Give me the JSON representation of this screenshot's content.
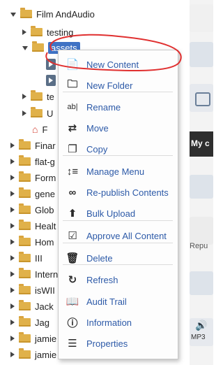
{
  "tree": {
    "root_label": "Film AndAudio",
    "testing": "testing",
    "assets": "assets",
    "te": "te",
    "u": "U",
    "f": "F",
    "items": [
      "Finar",
      "flat-g",
      "Form",
      "gene",
      "Glob",
      "Healt",
      "Hom",
      "III",
      "Intern",
      "isWII",
      "Jack",
      "Jag",
      "jamie",
      "jamie"
    ]
  },
  "menu": {
    "items": [
      {
        "label": "New Content",
        "icon": "new-content-icon"
      },
      {
        "label": "New Folder",
        "icon": "new-folder-icon"
      },
      {
        "label": "Rename",
        "icon": "rename-icon"
      },
      {
        "label": "Move",
        "icon": "move-icon"
      },
      {
        "label": "Copy",
        "icon": "copy-icon"
      },
      {
        "label": "Manage Menu",
        "icon": "manage-menu-icon"
      },
      {
        "label": "Re-publish Contents",
        "icon": "republish-icon"
      },
      {
        "label": "Bulk Upload",
        "icon": "bulk-upload-icon"
      },
      {
        "label": "Approve All Content",
        "icon": "approve-icon"
      },
      {
        "label": "Delete",
        "icon": "trash-icon"
      },
      {
        "label": "Refresh",
        "icon": "refresh-icon"
      },
      {
        "label": "Audit Trail",
        "icon": "audit-trail-icon"
      },
      {
        "label": "Information",
        "icon": "info-icon"
      },
      {
        "label": "Properties",
        "icon": "properties-icon"
      }
    ]
  },
  "right_strip": {
    "my_label": "My c",
    "repu_label": "Repu",
    "mp3_label": "MP3"
  },
  "colors": {
    "folder": "#e0b14a",
    "menu_text": "#2d5aa8",
    "selection": "#3f72c4",
    "annotation": "#e03030"
  }
}
